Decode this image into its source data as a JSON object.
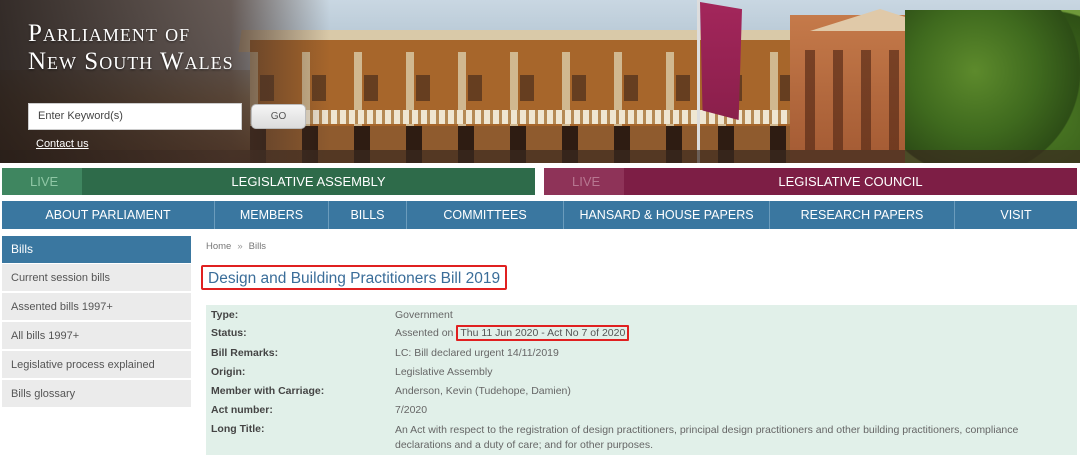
{
  "header": {
    "site_title_line1": "Parliament of",
    "site_title_line2": "New South Wales",
    "search_placeholder": "Enter Keyword(s)",
    "go_label": "GO",
    "contact_label": "Contact us"
  },
  "chambers": {
    "assembly": {
      "live_label": "LIVE",
      "label": "LEGISLATIVE ASSEMBLY"
    },
    "council": {
      "live_label": "LIVE",
      "label": "LEGISLATIVE COUNCIL"
    }
  },
  "nav": {
    "items": [
      "ABOUT PARLIAMENT",
      "MEMBERS",
      "BILLS",
      "COMMITTEES",
      "HANSARD & HOUSE PAPERS",
      "RESEARCH PAPERS",
      "VISIT"
    ]
  },
  "sidebar": {
    "heading": "Bills",
    "items": [
      "Current session bills",
      "Assented bills 1997+",
      "All bills 1997+",
      "Legislative process explained",
      "Bills glossary"
    ]
  },
  "breadcrumb": {
    "home": "Home",
    "sep": "»",
    "current": "Bills"
  },
  "bill": {
    "title": "Design and Building Practitioners Bill 2019",
    "type_label": "Type:",
    "type_value": "Government",
    "status_label": "Status:",
    "status_prefix": "Assented on",
    "status_value": "Thu 11 Jun 2020 - Act No 7 of 2020",
    "remarks_label": "Bill Remarks:",
    "remarks_value": "LC: Bill declared urgent 14/11/2019",
    "origin_label": "Origin:",
    "origin_value": "Legislative Assembly",
    "member_label": "Member with Carriage:",
    "member_value": "Anderson, Kevin (Tudehope, Damien)",
    "act_label": "Act number:",
    "act_value": "7/2020",
    "long_title_label": "Long Title:",
    "long_title_value": "An Act with respect to the registration of design practitioners, principal design practitioners and other building practitioners, compliance declarations and a duty of care; and for other purposes."
  },
  "colors": {
    "assembly_green": "#2e6b4a",
    "council_maroon": "#7d1e45",
    "nav_blue": "#3a77a0",
    "highlight_red": "#e02020",
    "details_bg": "#e1f0e9"
  }
}
